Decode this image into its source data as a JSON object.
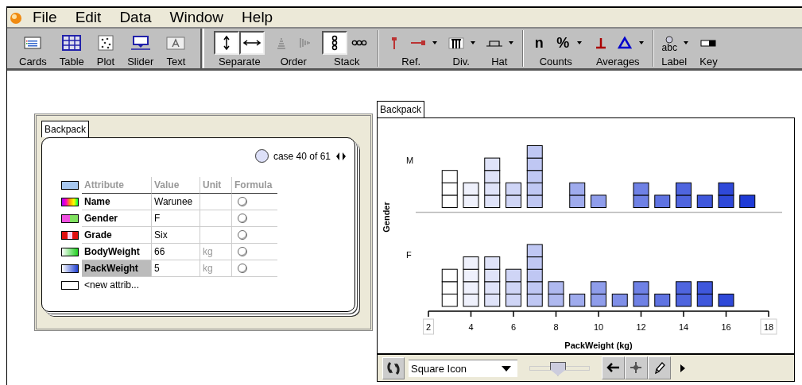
{
  "menu": [
    "File",
    "Edit",
    "Data",
    "Window",
    "Help"
  ],
  "toolbar": [
    [
      {
        "label": "Cards",
        "buttons": [
          {
            "kind": "cards",
            "selected": false
          }
        ]
      },
      {
        "label": "Table",
        "buttons": [
          {
            "kind": "table",
            "selected": false
          }
        ]
      },
      {
        "label": "Plot",
        "buttons": [
          {
            "kind": "plot",
            "selected": false
          }
        ]
      },
      {
        "label": "Slider",
        "buttons": [
          {
            "kind": "slider",
            "selected": false
          }
        ]
      },
      {
        "label": "Text",
        "buttons": [
          {
            "kind": "text",
            "selected": false
          }
        ]
      }
    ],
    [
      {
        "label": "Separate",
        "buttons": [
          {
            "kind": "vsplit",
            "selected": true
          },
          {
            "kind": "hsplit",
            "selected": true
          }
        ]
      },
      {
        "label": "Order",
        "buttons": [
          {
            "kind": "pyramid",
            "selected": false
          },
          {
            "kind": "bars",
            "selected": false
          }
        ]
      },
      {
        "label": "Stack",
        "buttons": [
          {
            "kind": "vstack",
            "selected": true
          },
          {
            "kind": "hstack",
            "selected": false
          }
        ]
      }
    ],
    [
      {
        "label": "Ref.",
        "buttons": [
          {
            "kind": "refv",
            "selected": false
          },
          {
            "kind": "refh",
            "selected": false,
            "menu": true
          }
        ]
      },
      {
        "label": "Div.",
        "buttons": [
          {
            "kind": "div",
            "selected": false,
            "menu": true
          }
        ]
      },
      {
        "label": "Hat",
        "buttons": [
          {
            "kind": "hat",
            "selected": false,
            "menu": true
          }
        ]
      }
    ],
    [
      {
        "label": "Counts",
        "buttons": [
          {
            "kind": "glyph",
            "text": "n",
            "selected": false
          },
          {
            "kind": "glyph",
            "text": "%",
            "selected": false,
            "menu": true
          }
        ]
      },
      {
        "label": "Averages",
        "buttons": [
          {
            "kind": "mean",
            "selected": false
          },
          {
            "kind": "median",
            "selected": false,
            "menu": true
          }
        ]
      }
    ],
    [
      {
        "label": "Label",
        "buttons": [
          {
            "kind": "label",
            "text": "abc",
            "selected": false,
            "menu": true
          }
        ]
      },
      {
        "label": "Key",
        "buttons": [
          {
            "kind": "key",
            "selected": false
          }
        ]
      }
    ]
  ],
  "card_window": {
    "tab": "Backpack",
    "case_label": "case 40 of 61",
    "columns": [
      "Attribute",
      "Value",
      "Unit",
      "Formula"
    ],
    "rows": [
      {
        "attribute": "Name",
        "value": "Warunee",
        "unit": "",
        "kind": "spectrum",
        "selected": false
      },
      {
        "attribute": "Gender",
        "value": "F",
        "unit": "",
        "kind": "pair",
        "selected": false
      },
      {
        "attribute": "Grade",
        "value": "Six",
        "unit": "",
        "kind": "triple",
        "selected": false
      },
      {
        "attribute": "BodyWeight",
        "value": "66",
        "unit": "kg",
        "kind": "green",
        "selected": false
      },
      {
        "attribute": "PackWeight",
        "value": "5",
        "unit": "kg",
        "kind": "blue",
        "selected": true
      }
    ],
    "new_attribute": "<new attrib..."
  },
  "graph_window": {
    "tab": "Backpack",
    "y_axis_title": "Gender",
    "groups": [
      "M",
      "F"
    ],
    "x_ticks": [
      "2",
      "4",
      "6",
      "8",
      "10",
      "12",
      "14",
      "16",
      "18"
    ],
    "x_axis_title": "PackWeight (kg)",
    "icon_menu": "Square Icon",
    "size_slider": {
      "level": 0.46
    }
  }
}
